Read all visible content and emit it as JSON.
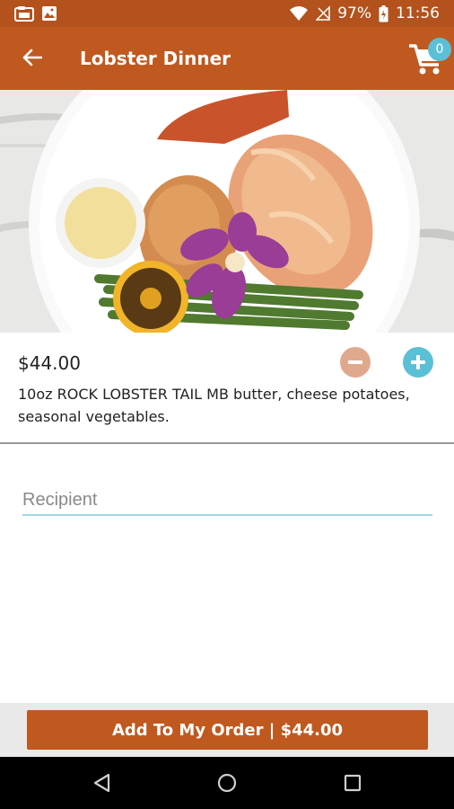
{
  "status_bar": {
    "battery": "97%",
    "time": "11:56"
  },
  "app_bar": {
    "title": "Lobster Dinner",
    "cart_count": "0"
  },
  "item": {
    "price": "$44.00",
    "description": "10oz ROCK LOBSTER TAIL  MB butter, cheese potatoes, seasonal vegetables."
  },
  "form": {
    "recipient_placeholder": "Recipient"
  },
  "action": {
    "add_label": "Add To My Order | $44.00"
  },
  "colors": {
    "primary": "#c0591f",
    "status_bar": "#b3521c",
    "accent": "#5bc0d6",
    "minus": "#e0a98e"
  }
}
